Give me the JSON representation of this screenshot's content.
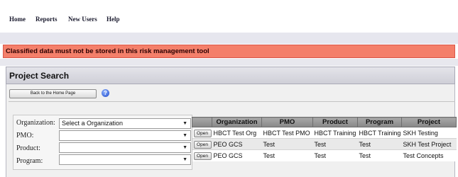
{
  "nav": {
    "items": [
      {
        "label": "Home"
      },
      {
        "label": "Reports"
      },
      {
        "label": "New Users"
      },
      {
        "label": "Help"
      }
    ]
  },
  "alert": {
    "message": "Classified data must not be stored in this risk management tool",
    "color": "#f47f6a"
  },
  "panel": {
    "title": "Project Search",
    "back_label": "Back to the Home Page",
    "help_icon": "help-circle-icon"
  },
  "form": {
    "organization": {
      "label": "Organization:",
      "value": "Select a Organization"
    },
    "pmo": {
      "label": "PMO:",
      "value": ""
    },
    "product": {
      "label": "Product:",
      "value": ""
    },
    "program": {
      "label": "Program:",
      "value": ""
    }
  },
  "results": {
    "open_label": "Open",
    "columns": [
      "",
      "Organization",
      "PMO",
      "Product",
      "Program",
      "Project"
    ],
    "rows": [
      [
        "HBCT Test Org",
        "HBCT Test PMO",
        "HBCT Training",
        "HBCT Training",
        "SKH Testing"
      ],
      [
        "PEO GCS",
        "Test",
        "Test",
        "Test",
        "SKH Test Project"
      ],
      [
        "PEO GCS",
        "Test",
        "Test",
        "Test",
        "Test Concepts"
      ]
    ]
  }
}
